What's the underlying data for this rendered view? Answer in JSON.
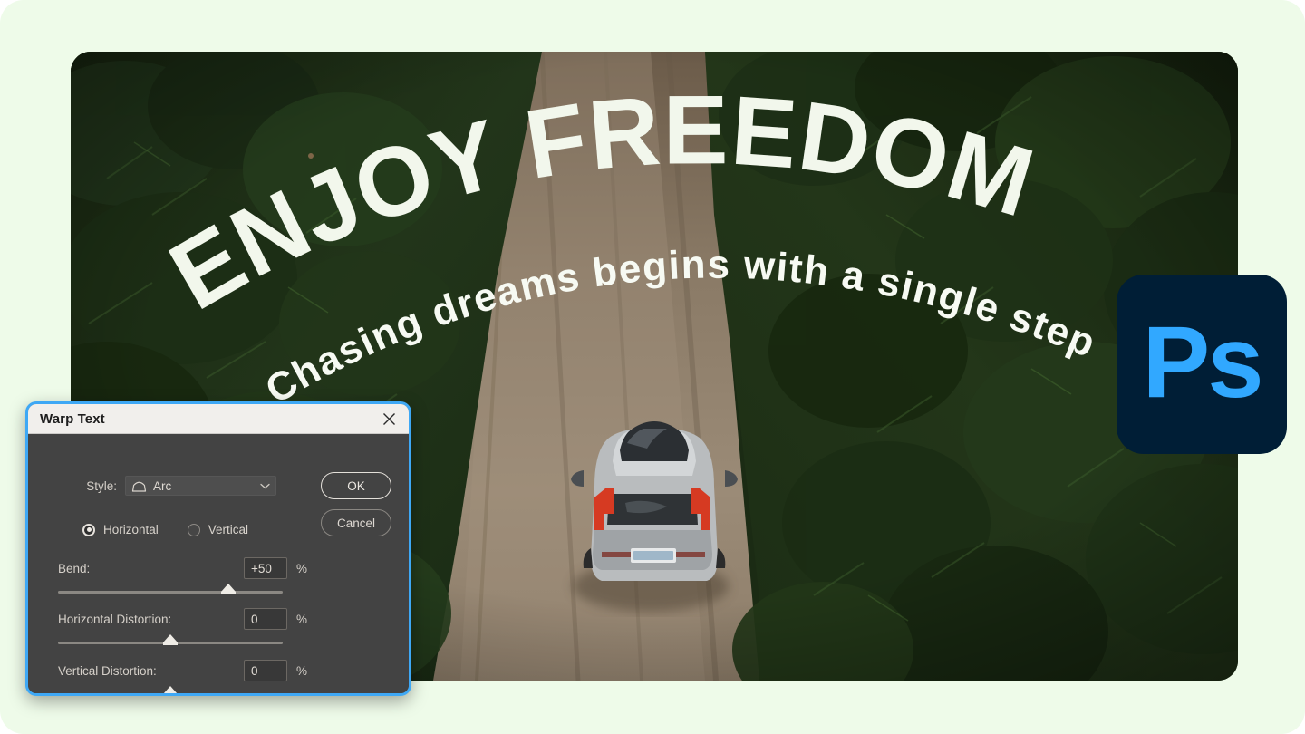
{
  "canvas": {
    "background_color": "#eefbe9",
    "headline": "ENJOY FREEDOM",
    "subheadline": "Chasing dreams begins with a single step",
    "text_color": "#f4f8ee"
  },
  "badge": {
    "label": "Ps",
    "name": "photoshop-logo",
    "bg_color": "#001e36",
    "fg_color": "#31a8ff"
  },
  "dialog": {
    "title": "Warp Text",
    "close_icon": "close-icon",
    "style": {
      "label": "Style:",
      "value": "Arc",
      "icon": "arc-style-icon",
      "chevron": "chevron-down-icon"
    },
    "orientation": {
      "options": [
        {
          "label": "Horizontal",
          "selected": true
        },
        {
          "label": "Vertical",
          "selected": false
        }
      ]
    },
    "buttons": {
      "ok": "OK",
      "cancel": "Cancel"
    },
    "sliders": [
      {
        "label": "Bend:",
        "value": "+50",
        "unit": "%",
        "thumb_percent": 76
      },
      {
        "label": "Horizontal Distortion:",
        "value": "0",
        "unit": "%",
        "thumb_percent": 50
      },
      {
        "label": "Vertical Distortion:",
        "value": "0",
        "unit": "%",
        "thumb_percent": 50
      }
    ],
    "accent_border_color": "#3ea8f5",
    "body_color": "#434343",
    "titlebar_color": "#f1efec"
  }
}
